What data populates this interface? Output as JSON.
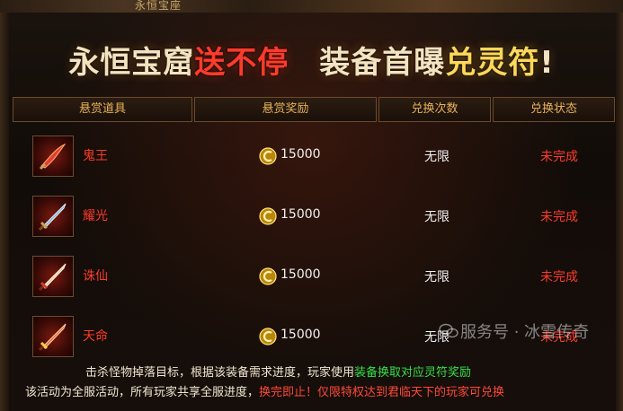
{
  "header": {
    "strip_title": "永恒宝座",
    "banner": {
      "part1": "永恒宝窟",
      "part2": "送不停",
      "part3": "装备首曝",
      "part4": "兑灵符",
      "part5": "!"
    }
  },
  "table": {
    "columns": [
      "悬赏道具",
      "悬赏奖励",
      "兑换次数",
      "兑换状态"
    ],
    "rows": [
      {
        "item": "鬼王",
        "reward": "15000",
        "count": "无限",
        "status": "未完成"
      },
      {
        "item": "耀光",
        "reward": "15000",
        "count": "无限",
        "status": "未完成"
      },
      {
        "item": "诛仙",
        "reward": "15000",
        "count": "无限",
        "status": "未完成"
      },
      {
        "item": "天命",
        "reward": "15000",
        "count": "无限",
        "status": "未完成"
      }
    ]
  },
  "footer": {
    "line1_a": "击杀怪物掉落目标，根据该装备需求进度，玩家使用",
    "line1_b": "装备换取对应灵符奖励",
    "line2_a": "该活动为全服活动，所有玩家共享全服进度，",
    "line2_b": "换完即止！仅限特权达到君临天下的玩家可兑换"
  },
  "watermark": "服务号 · 冰雪传奇",
  "colors": {
    "accent_gold": "#e6b35a",
    "status_red": "#ff3b2a",
    "highlight_green": "#34e04a"
  },
  "icons": [
    "blade-item-icon",
    "sword-item-icon",
    "coin-icon",
    "wechat-icon"
  ]
}
